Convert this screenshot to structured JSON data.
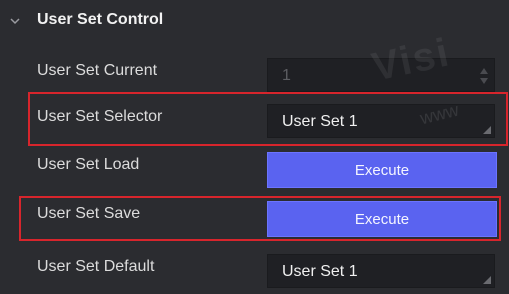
{
  "section": {
    "title": "User Set Control",
    "expanded_icon": "chevron-down-icon"
  },
  "rows": [
    {
      "label": "User Set Current",
      "value": "1",
      "kind": "spinbox",
      "state": "disabled"
    },
    {
      "label": "User Set Selector",
      "value": "User Set 1",
      "kind": "dropdown",
      "highlighted": true
    },
    {
      "label": "User Set Load",
      "value": "Execute",
      "kind": "button"
    },
    {
      "label": "User Set Save",
      "value": "Execute",
      "kind": "button",
      "highlighted": true
    },
    {
      "label": "User Set Default",
      "value": "User Set 1",
      "kind": "dropdown"
    }
  ],
  "watermark": {
    "text": "Visi",
    "subtext": "www"
  },
  "colors": {
    "background": "#2b2c30",
    "field": "#1f2024",
    "button": "#5a63f0",
    "highlight": "#d7252c"
  }
}
